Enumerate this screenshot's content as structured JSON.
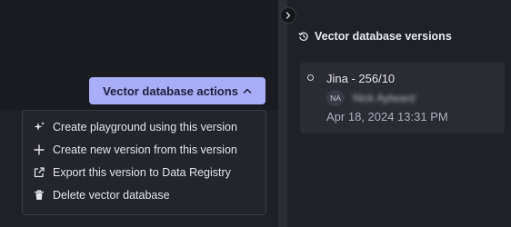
{
  "actions": {
    "button_label": "Vector database actions",
    "menu": [
      {
        "label": "Create playground using this version",
        "icon": "sparkle-icon"
      },
      {
        "label": "Create new version from this version",
        "icon": "plus-icon"
      },
      {
        "label": "Export this version to Data Registry",
        "icon": "export-icon"
      },
      {
        "label": "Delete vector database",
        "icon": "trash-icon"
      }
    ]
  },
  "versions_panel": {
    "title": "Vector database versions",
    "items": [
      {
        "name": "Jina - 256/10",
        "author_initials": "NA",
        "author_name": "Nick Aylward",
        "date": "Apr 18, 2024 13:31 PM"
      }
    ]
  },
  "colors": {
    "accent": "#a8adf5",
    "background": "#1b1c21",
    "panel": "#202127",
    "card": "#2b2c33"
  }
}
